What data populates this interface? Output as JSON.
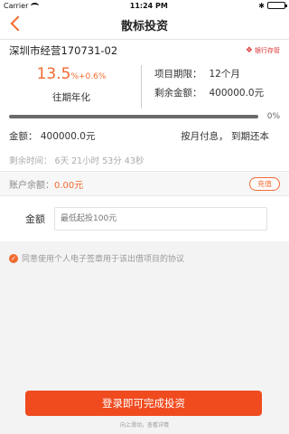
{
  "status_bar": {
    "carrier": "Carrier",
    "time": "11:24 PM"
  },
  "nav": {
    "title": "散标投资"
  },
  "project": {
    "name": "深圳市经营170731-02",
    "bank_badge": "银行存管",
    "rate_main": "13.5",
    "rate_extra": "%+0.6%",
    "rate_label": "往期年化",
    "term_label": "项目期限：",
    "term_value": "12个月",
    "remaining_label": "剩余金额：",
    "remaining_value": "400000.0元",
    "progress_percent": "0%",
    "progress_value": 0,
    "amount_text": "金额：  400000.0元",
    "repay_text": "按月付息，  到期还本",
    "remain_time": "剩余时间：  6天  21小时  53分  43秒"
  },
  "balance": {
    "label": "账户余额：",
    "value": "0.00元",
    "recharge_label": "充值"
  },
  "invest": {
    "amount_label": "金额",
    "placeholder": "最低起投100元"
  },
  "agreement": {
    "text": "同意使用个人电子签章用于该出借项目的协议"
  },
  "submit": {
    "label": "登录即可完成投资"
  },
  "scroll_hint": "向上滑动，查看详情",
  "colors": {
    "accent": "#f26a2f",
    "button": "#f04a1f"
  }
}
